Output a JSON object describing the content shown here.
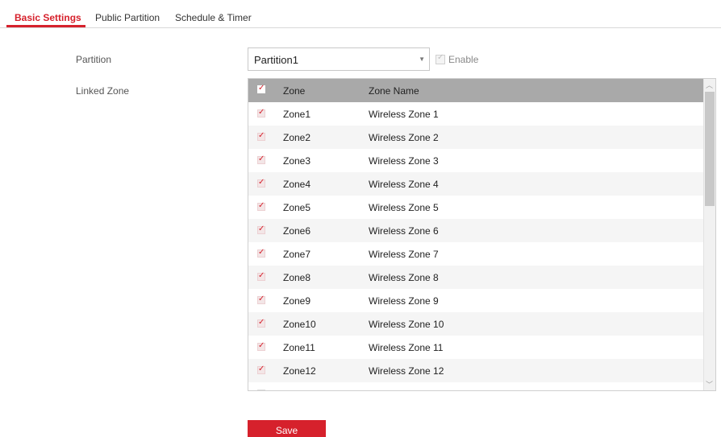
{
  "tabs": [
    {
      "label": "Basic Settings",
      "active": true
    },
    {
      "label": "Public Partition",
      "active": false
    },
    {
      "label": "Schedule & Timer",
      "active": false
    }
  ],
  "form": {
    "partition_label": "Partition",
    "partition_value": "Partition1",
    "enable_label": "Enable",
    "enable_checked": true,
    "linked_zone_label": "Linked Zone"
  },
  "table": {
    "headers": {
      "zone": "Zone",
      "zone_name": "Zone Name"
    },
    "rows": [
      {
        "zone": "Zone1",
        "name": "Wireless Zone 1",
        "checked": true
      },
      {
        "zone": "Zone2",
        "name": "Wireless Zone 2",
        "checked": true
      },
      {
        "zone": "Zone3",
        "name": "Wireless Zone 3",
        "checked": true
      },
      {
        "zone": "Zone4",
        "name": "Wireless Zone 4",
        "checked": true
      },
      {
        "zone": "Zone5",
        "name": "Wireless Zone 5",
        "checked": true
      },
      {
        "zone": "Zone6",
        "name": "Wireless Zone 6",
        "checked": true
      },
      {
        "zone": "Zone7",
        "name": "Wireless Zone 7",
        "checked": true
      },
      {
        "zone": "Zone8",
        "name": "Wireless Zone 8",
        "checked": true
      },
      {
        "zone": "Zone9",
        "name": "Wireless Zone 9",
        "checked": true
      },
      {
        "zone": "Zone10",
        "name": "Wireless Zone 10",
        "checked": true
      },
      {
        "zone": "Zone11",
        "name": "Wireless Zone 11",
        "checked": true
      },
      {
        "zone": "Zone12",
        "name": "Wireless Zone 12",
        "checked": true
      }
    ]
  },
  "save_label": "Save",
  "colors": {
    "accent": "#d6212c",
    "header_bg": "#a9a9a9"
  },
  "icons": {
    "check": "check-icon",
    "dropdown": "chevron-down-icon",
    "scroll_up": "chevron-up-icon",
    "scroll_down": "chevron-down-icon"
  }
}
